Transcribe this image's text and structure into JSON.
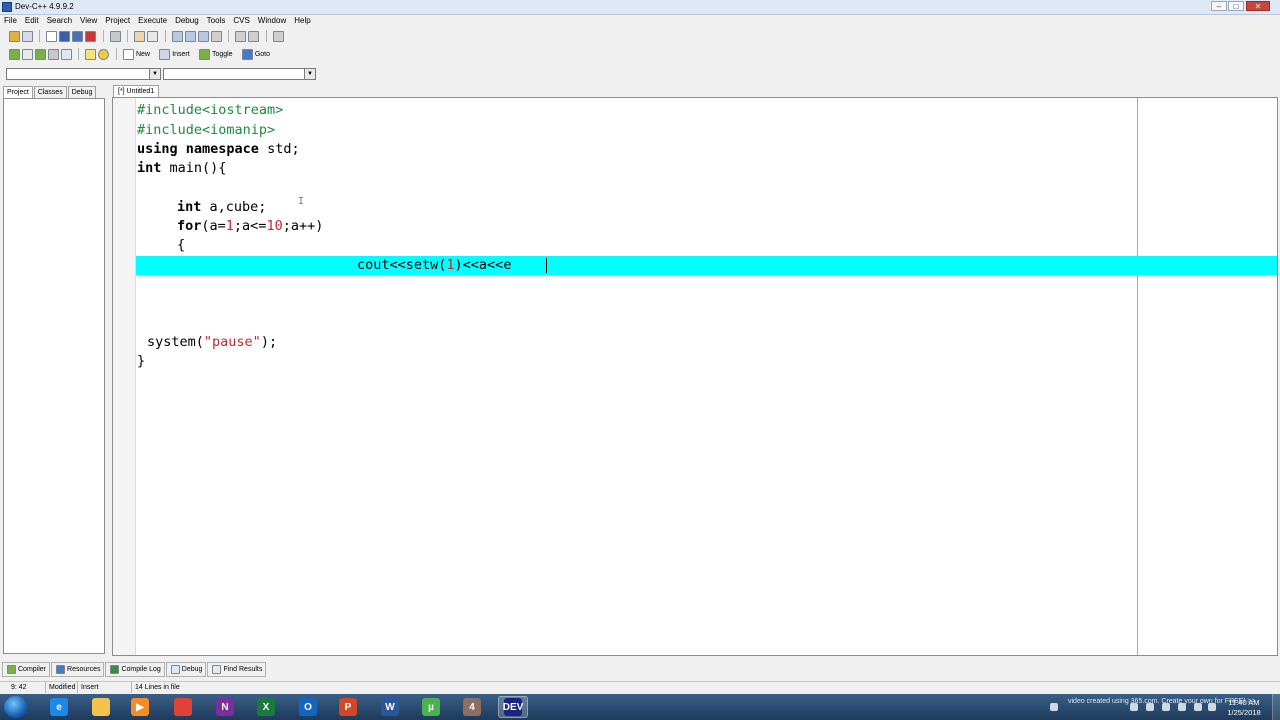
{
  "window": {
    "title": "Dev-C++ 4.9.9.2",
    "min_glyph": "–",
    "max_glyph": "□",
    "close_glyph": "✕"
  },
  "menu": [
    "File",
    "Edit",
    "Search",
    "View",
    "Project",
    "Execute",
    "Debug",
    "Tools",
    "CVS",
    "Window",
    "Help"
  ],
  "toolbar2": {
    "new_label": "New",
    "insert_label": "Insert",
    "toggle_label": "Toggle",
    "goto_label": "Goto"
  },
  "combo_arrow": "▼",
  "left_tabs": [
    "Project",
    "Classes",
    "Debug"
  ],
  "editor_tab": "[*] Untitled1",
  "code": {
    "l1": "#include<iostream>",
    "l2": "#include<iomanip>",
    "l3_kw1": "using",
    "l3_kw2": "namespace",
    "l3_rest": " std;",
    "l4_kw": "int",
    "l4_rest": " main(){",
    "l6_kw": "int",
    "l6_rest": " a,cube;",
    "l7_kw": "for",
    "l7_p1": "(a=",
    "l7_n1": "1",
    "l7_p2": ";a<=",
    "l7_n2": "10",
    "l7_p3": ";a++)",
    "l8": "{",
    "l9_p1": "cout<<setw(",
    "l9_n1": "1",
    "l9_p2": ")<<a<<e",
    "l12_p1": "system(",
    "l12_str": "\"pause\"",
    "l12_p2": ");",
    "l13": "}"
  },
  "ibeam": "I",
  "bottom_tabs": [
    "Compiler",
    "Resources",
    "Compile Log",
    "Debug",
    "Find Results"
  ],
  "status": {
    "position": "9: 42",
    "modified": "Modified",
    "mode": "Insert",
    "lines": "14 Lines in file"
  },
  "taskbar": {
    "apps": [
      {
        "name": "internet-explorer",
        "glyph": "e",
        "color": "#1e88e5"
      },
      {
        "name": "file-explorer",
        "glyph": "",
        "color": "#f2c14e"
      },
      {
        "name": "media-player",
        "glyph": "▶",
        "color": "#f28c28"
      },
      {
        "name": "chrome",
        "glyph": "",
        "color": "#db4437"
      },
      {
        "name": "onenote",
        "glyph": "N",
        "color": "#7b2e9e"
      },
      {
        "name": "excel",
        "glyph": "X",
        "color": "#1d7a3e"
      },
      {
        "name": "outlook",
        "glyph": "O",
        "color": "#1565c0"
      },
      {
        "name": "powerpoint",
        "glyph": "P",
        "color": "#d24726"
      },
      {
        "name": "word",
        "glyph": "W",
        "color": "#2b579a"
      },
      {
        "name": "utorrent",
        "glyph": "µ",
        "color": "#4caf50"
      },
      {
        "name": "photo-app",
        "glyph": "4",
        "color": "#8d6e63"
      },
      {
        "name": "dev-cpp",
        "glyph": "DEV",
        "color": "#1a237e"
      }
    ],
    "tray_text": "video created using 365.com. Create your own for FREE! >>",
    "time": "11:40 AM",
    "date": "1/25/2018"
  }
}
